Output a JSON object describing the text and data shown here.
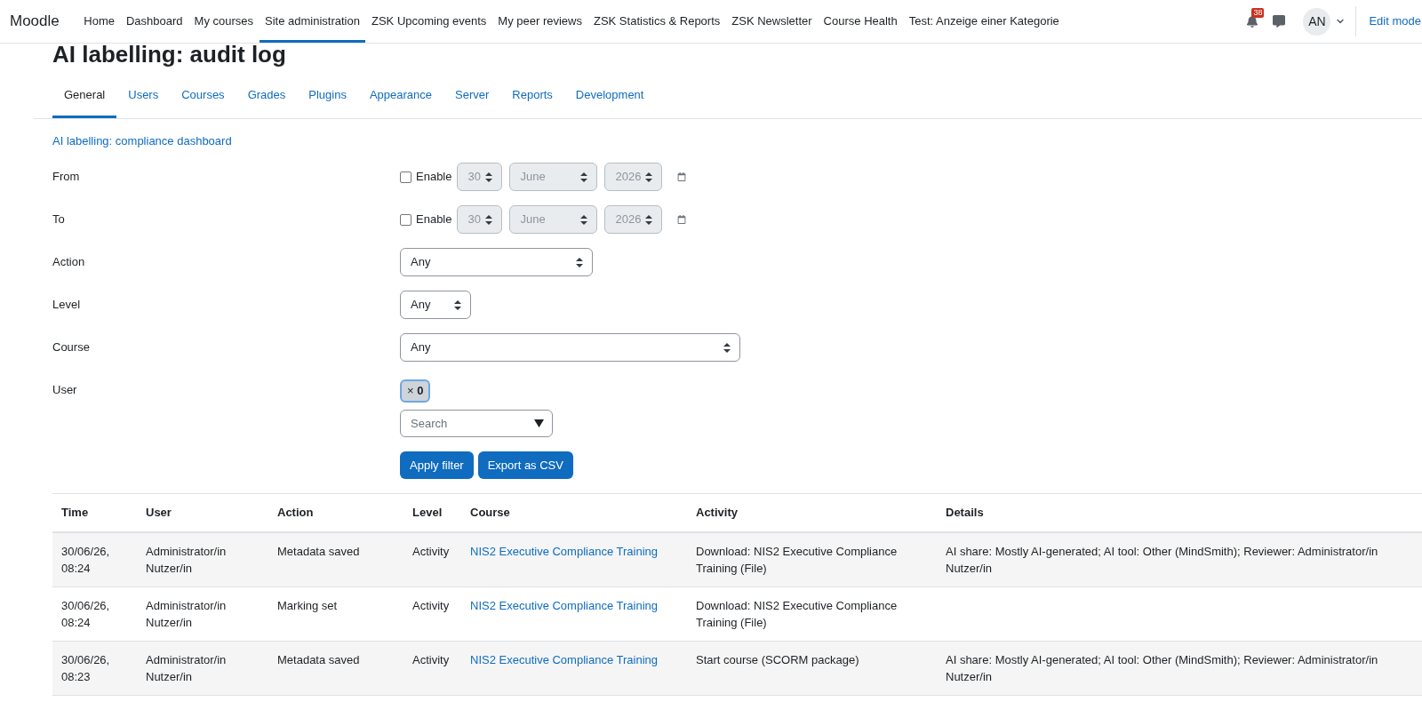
{
  "navbar": {
    "brand": "Moodle",
    "items": [
      {
        "label": "Home",
        "selected": false
      },
      {
        "label": "Dashboard",
        "selected": false
      },
      {
        "label": "My courses",
        "selected": false
      },
      {
        "label": "Site administration",
        "selected": true
      },
      {
        "label": "ZSK Upcoming events",
        "selected": false
      },
      {
        "label": "My peer reviews",
        "selected": false
      },
      {
        "label": "ZSK Statistics & Reports",
        "selected": false
      },
      {
        "label": "ZSK Newsletter",
        "selected": false
      },
      {
        "label": "Course Health",
        "selected": false
      },
      {
        "label": "Test: Anzeige einer Kategorie",
        "selected": false
      }
    ],
    "notification_count": "38",
    "avatar_initials": "AN",
    "edit_mode_label": "Edit mode"
  },
  "page_title": "AI labelling: audit log",
  "tabs": [
    {
      "label": "General",
      "selected": true
    },
    {
      "label": "Users",
      "selected": false
    },
    {
      "label": "Courses",
      "selected": false
    },
    {
      "label": "Grades",
      "selected": false
    },
    {
      "label": "Plugins",
      "selected": false
    },
    {
      "label": "Appearance",
      "selected": false
    },
    {
      "label": "Server",
      "selected": false
    },
    {
      "label": "Reports",
      "selected": false
    },
    {
      "label": "Development",
      "selected": false
    }
  ],
  "dashboard_link": "AI labelling: compliance dashboard",
  "filters": [
    {
      "kind": "date",
      "label": "From",
      "enable_label": "Enable",
      "enabled": false,
      "day": "30",
      "month": "June",
      "year": "2026"
    },
    {
      "kind": "date",
      "label": "To",
      "enable_label": "Enable",
      "enabled": false,
      "day": "30",
      "month": "June",
      "year": "2026"
    },
    {
      "kind": "select",
      "label": "Action",
      "value": "Any"
    },
    {
      "kind": "select",
      "label": "Level",
      "value": "Any"
    },
    {
      "kind": "select",
      "label": "Course",
      "value": "Any"
    },
    {
      "kind": "autocomplete",
      "label": "User",
      "chip": "× **0**",
      "placeholder": "Search"
    }
  ],
  "buttons": [
    "Apply filter",
    "Export as CSV"
  ],
  "table": {
    "columns": [
      "Time",
      "User",
      "Action",
      "Level",
      "Course",
      "Activity",
      "Details"
    ],
    "rows": [
      {
        "time": "30/06/26, 08:24",
        "user": "Administrator/in Nutzer/in",
        "action": "Metadata saved",
        "level": "Activity",
        "course": "NIS2 Executive Compliance Training",
        "activity": "Download: NIS2 Executive Compliance Training (File)",
        "details": "AI share: Mostly AI-generated; AI tool: Other (MindSmith); Reviewer: Administrator/in Nutzer/in"
      },
      {
        "time": "30/06/26, 08:24",
        "user": "Administrator/in Nutzer/in",
        "action": "Marking set",
        "level": "Activity",
        "course": "NIS2 Executive Compliance Training",
        "activity": "Download: NIS2 Executive Compliance Training (File)"
      },
      {
        "time": "30/06/26, 08:23",
        "user": "Administrator/in Nutzer/in",
        "action": "Metadata saved",
        "level": "Activity",
        "course": "NIS2 Executive Compliance Training",
        "activity": "Start course (SCORM package)",
        "details": "AI share: Mostly AI-generated; AI tool: Other (MindSmith); Reviewer: Administrator/in Nutzer/in"
      }
    ]
  }
}
